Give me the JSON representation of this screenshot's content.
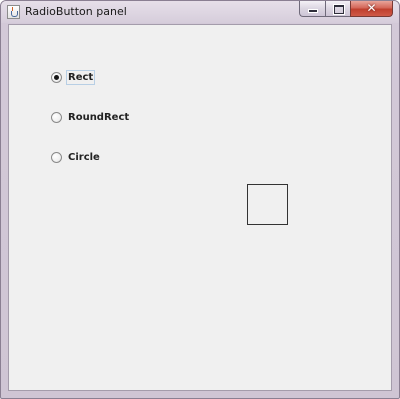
{
  "window": {
    "title": "RadioButton panel",
    "controls": {
      "minimize": "minimize-button",
      "maximize": "maximize-button",
      "close": "close-button"
    }
  },
  "radio_group": {
    "options": [
      {
        "label": "Rect",
        "checked": true
      },
      {
        "label": "RoundRect",
        "checked": false
      },
      {
        "label": "Circle",
        "checked": false
      }
    ],
    "selected": "Rect"
  },
  "canvas": {
    "shape": "rect",
    "stroke_color": "#333333"
  },
  "colors": {
    "panel_background": "#f0f0f0",
    "title_bar": "#d6cddb",
    "close_button": "#c0402e"
  },
  "icons": {
    "app_icon": "java-cup-icon",
    "close_glyph": "✕"
  }
}
